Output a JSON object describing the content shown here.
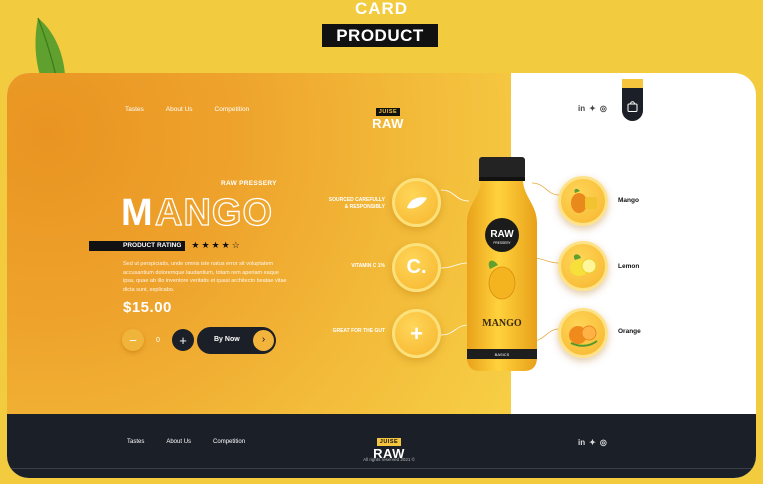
{
  "poster": {
    "line1": "CARD",
    "line2": "PRODUCT"
  },
  "nav": {
    "items": [
      "Tastes",
      "About Us",
      "Competition"
    ]
  },
  "brand": {
    "small": "JUISE",
    "big": "RAW"
  },
  "hero": {
    "subbrand": "RAW PRESSERY",
    "title_first": "M",
    "title_rest": "ANGO",
    "rating_label": "PRODUCT RATING",
    "rating": 4,
    "rating_max": 5,
    "description": "Sed ut perspiciatis, unde omnis iste natus error sit voluptatem accusantium doloremque laudantium, totam rem aperiam eaque ipsa, quae ab illo inventore veritatis et quasi architecto beatae vitae dicta sunt, explicabo.",
    "price": "$15.00",
    "quantity": "0",
    "buy_label": "By Now"
  },
  "features": [
    {
      "label_line1": "SOURCED CAREFULLY",
      "label_line2": "& RESPONSIBLY",
      "icon": "leaf-icon"
    },
    {
      "label_line1": "VITAMIN C 1%",
      "label_line2": "",
      "icon": "letter-c-icon",
      "glyph": "C."
    },
    {
      "label_line1": "GREAT FOR THE GUT",
      "label_line2": "",
      "icon": "plus-icon",
      "glyph": "+"
    }
  ],
  "bottle": {
    "cap_brand": "RAW",
    "cap_sub": "PRESSERY",
    "product": "MANGO",
    "band": "BASICS"
  },
  "fruits": [
    {
      "name": "Mango",
      "icon": "mango-fruit-icon"
    },
    {
      "name": "Lemon",
      "icon": "lemon-fruit-icon"
    },
    {
      "name": "Orange",
      "icon": "orange-fruit-icon"
    }
  ],
  "social": {
    "linkedin": "in",
    "twitter": "✦",
    "instagram": "◎"
  },
  "footer": {
    "nav": [
      "Tastes",
      "About Us",
      "Competition"
    ],
    "rights": "All rights reserved 2021 ©"
  },
  "colors": {
    "background": "#f2cb3e",
    "dark": "#1b1f27",
    "accent": "#f3b43c",
    "panel_orange": "#eea32c"
  }
}
